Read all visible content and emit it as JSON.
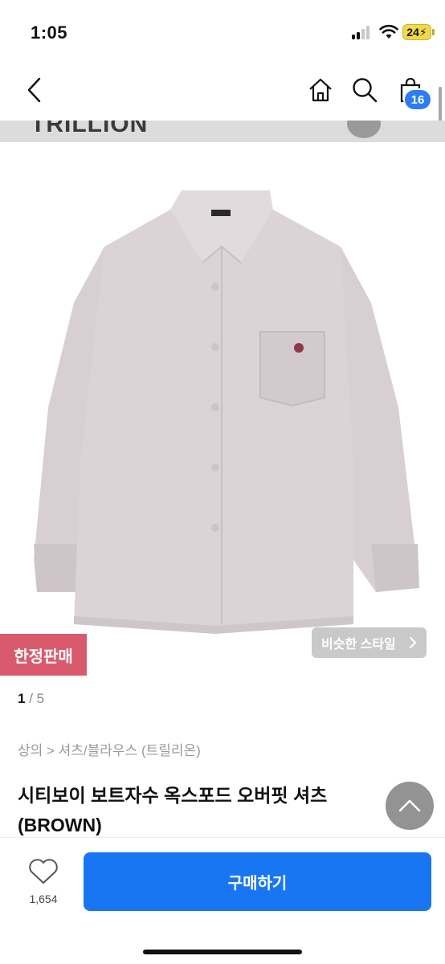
{
  "status_bar": {
    "time": "1:05",
    "battery": "24",
    "icons": [
      "signal-icon",
      "wifi-icon",
      "battery-charging-icon"
    ]
  },
  "nav": {
    "icons": [
      "chevron-left-icon",
      "home-icon",
      "search-icon",
      "shopping-bag-icon"
    ],
    "cart_count": "16"
  },
  "product_image": {
    "brand_strip_text": "TRILLION",
    "shirt_color": "#d9d1d4"
  },
  "badges": {
    "limited": "한정판매",
    "similar_style": "비슷한 스타일"
  },
  "pager": {
    "current": "1",
    "total": "5"
  },
  "breadcrumb": "상의 > 셔츠/블라우스 (트릴리온)",
  "product": {
    "title_line1": "시티보이 보트자수 옥스포드 오버핏 셔츠",
    "title_line2": "(BROWN)"
  },
  "bottom_bar": {
    "like_count": "1,654",
    "buy_label": "구매하기"
  },
  "colors": {
    "accent": "#1876f2",
    "badge_blue": "#2d7cf6",
    "limited_badge": "#d95a6c"
  }
}
